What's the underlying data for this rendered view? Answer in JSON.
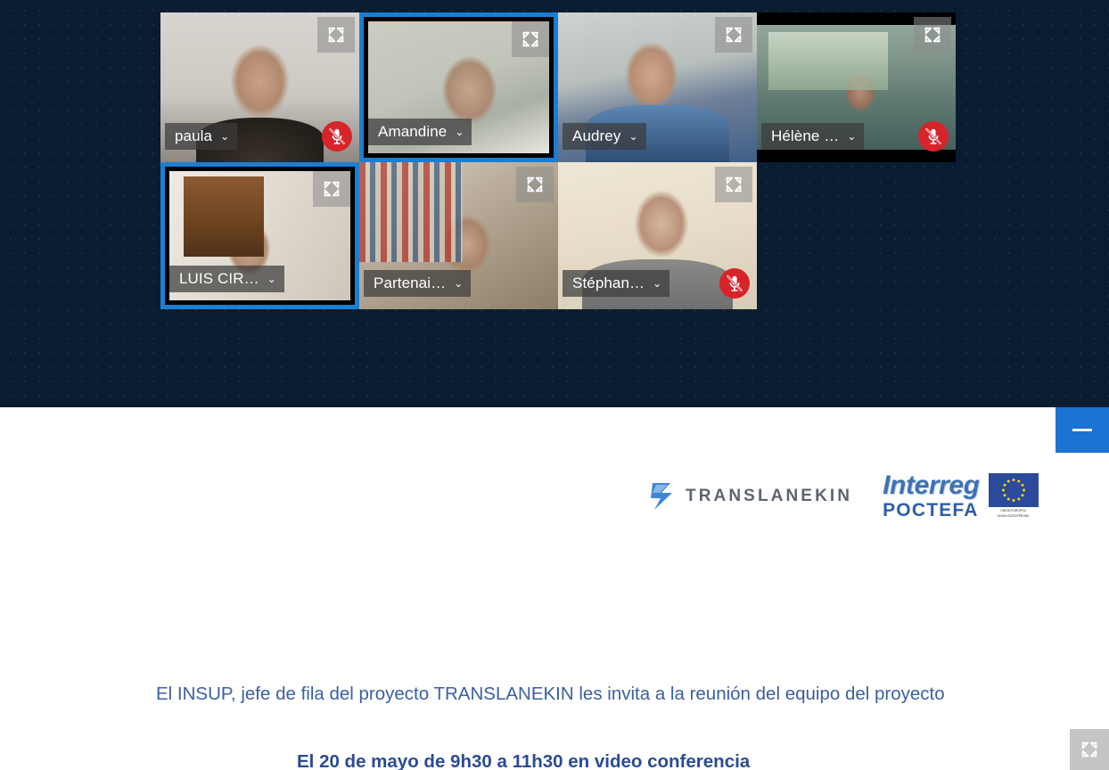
{
  "meeting": {
    "participants": [
      {
        "name": "paula",
        "caret": "⌄",
        "muted": true,
        "speaking": false,
        "row": 1,
        "scene": "scene-paula",
        "letterbox": false,
        "inset": false
      },
      {
        "name": "Amandine",
        "caret": "⌄",
        "muted": false,
        "speaking": true,
        "row": 1,
        "scene": "scene-amandine",
        "letterbox": false,
        "inset": true
      },
      {
        "name": "Audrey",
        "caret": "⌄",
        "muted": false,
        "speaking": false,
        "row": 1,
        "scene": "scene-audrey",
        "letterbox": false,
        "inset": false
      },
      {
        "name": "Hélène …",
        "caret": "⌄",
        "muted": true,
        "speaking": false,
        "row": 1,
        "scene": "scene-helene",
        "letterbox": true,
        "inset": false
      },
      {
        "name": "LUIS CIR…",
        "caret": "⌄",
        "muted": false,
        "speaking": true,
        "row": 2,
        "scene": "scene-luis",
        "letterbox": false,
        "inset": true
      },
      {
        "name": "Partenai…",
        "caret": "⌄",
        "muted": false,
        "speaking": false,
        "row": 2,
        "scene": "scene-partenai",
        "letterbox": false,
        "inset": false
      },
      {
        "name": "Stéphan…",
        "caret": "⌄",
        "muted": true,
        "speaking": false,
        "row": 2,
        "scene": "scene-stephane",
        "letterbox": false,
        "inset": false
      }
    ],
    "expand_icon": "expand-icon",
    "mic_muted_icon": "microphone-muted-icon",
    "name_dropdown_icon": "chevron-down-icon"
  },
  "content": {
    "collapse_label": "",
    "collapse_icon": "minimize-icon",
    "fullscreen_icon": "fullscreen-icon",
    "logos": {
      "translanekin": "TRANSLANEKIN",
      "interreg": "Interreg",
      "poctefa": "POCTEFA",
      "eu_flag_caption_line1": "UNIÓN EUROPEA",
      "eu_flag_caption_line2": "UNION EUROPÉENNE"
    },
    "slide": {
      "lead": "El INSUP, jefe de fila del proyecto TRANSLANEKIN les invita a la reunión del equipo del proyecto",
      "subheading": "El 20 de mayo de 9h30 a 11h30 en video conferencia"
    }
  },
  "colors": {
    "stage_bg": "#0a1c30",
    "accent_blue": "#1b73d4",
    "speaking_border": "#1a7fd4",
    "mute_red": "#d6242a",
    "slide_text": "#3b5fa5",
    "slide_sub": "#2a4b96"
  }
}
